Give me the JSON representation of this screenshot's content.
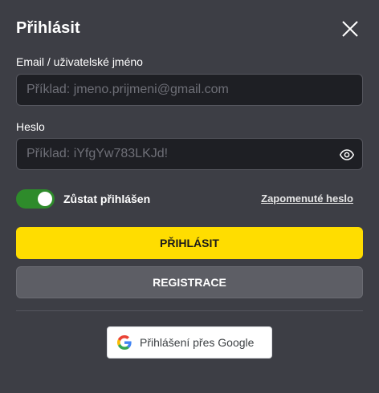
{
  "dialog": {
    "title": "Přihlásit",
    "close_icon": "close-icon"
  },
  "email_field": {
    "label": "Email / uživatelské jméno",
    "value": "",
    "placeholder": "Příklad: jmeno.prijmeni@gmail.com"
  },
  "password_field": {
    "label": "Heslo",
    "value": "",
    "placeholder": "Příklad: iYfgYw783LKJd!",
    "toggle_icon": "eye-icon"
  },
  "remember_me": {
    "label": "Zůstat přihlášen",
    "checked": true,
    "color": "#2e8b2b"
  },
  "forgot_password": {
    "label": "Zapomenuté heslo"
  },
  "buttons": {
    "login_label": "PŘIHLÁSIT",
    "login_color": "#ffdd00",
    "register_label": "REGISTRACE",
    "register_color": "#5d5e65"
  },
  "google_signin": {
    "label": "Přihlášení přes Google",
    "icon": "google-logo-icon"
  },
  "colors": {
    "background": "#3d3e45",
    "input_background": "#1e1f24"
  }
}
